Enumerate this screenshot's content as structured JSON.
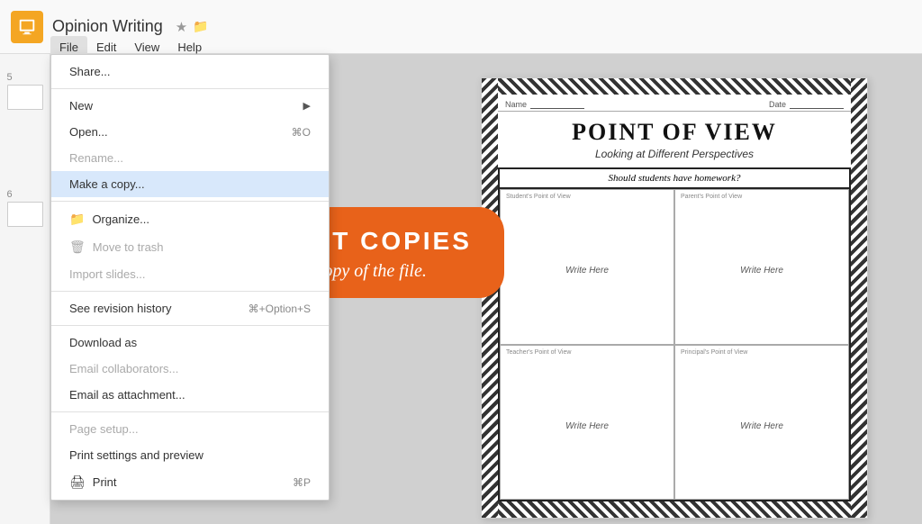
{
  "app": {
    "icon_label": "slides-icon",
    "title": "Opinion Writing",
    "star_icon": "★",
    "folder_icon": "📁"
  },
  "menu": {
    "items": [
      "File",
      "Edit",
      "View",
      "Help"
    ],
    "active": "File"
  },
  "dropdown": {
    "items": [
      {
        "id": "share",
        "label": "Share...",
        "shortcut": "",
        "disabled": false,
        "divider_after": true
      },
      {
        "id": "new",
        "label": "New",
        "shortcut": "",
        "arrow": "▶",
        "disabled": false,
        "divider_after": false
      },
      {
        "id": "open",
        "label": "Open...",
        "shortcut": "⌘O",
        "disabled": false,
        "divider_after": false
      },
      {
        "id": "rename",
        "label": "Rename...",
        "shortcut": "",
        "disabled": true,
        "divider_after": false
      },
      {
        "id": "make-copy",
        "label": "Make a copy...",
        "shortcut": "",
        "highlighted": true,
        "disabled": false,
        "divider_after": true
      },
      {
        "id": "organize",
        "label": "Organize...",
        "shortcut": "",
        "icon": "folder",
        "disabled": false,
        "divider_after": false
      },
      {
        "id": "move-trash",
        "label": "Move to trash",
        "shortcut": "",
        "icon": "trash",
        "disabled": true,
        "divider_after": false
      },
      {
        "id": "import",
        "label": "Import slides...",
        "shortcut": "",
        "disabled": true,
        "divider_after": true
      },
      {
        "id": "revision",
        "label": "See revision history",
        "shortcut": "⌘+Option+S",
        "disabled": false,
        "divider_after": true
      },
      {
        "id": "download",
        "label": "Download as",
        "shortcut": "",
        "disabled": false,
        "divider_after": false
      },
      {
        "id": "email-collab",
        "label": "Email collaborators...",
        "shortcut": "",
        "disabled": true,
        "divider_after": false
      },
      {
        "id": "email-attach",
        "label": "Email as attachment...",
        "shortcut": "",
        "disabled": false,
        "divider_after": true
      },
      {
        "id": "page-setup",
        "label": "Page setup...",
        "shortcut": "",
        "disabled": true,
        "divider_after": false
      },
      {
        "id": "print-preview",
        "label": "Print settings and preview",
        "shortcut": "",
        "disabled": false,
        "divider_after": false
      },
      {
        "id": "print",
        "label": "Print",
        "shortcut": "⌘P",
        "icon": "print",
        "disabled": false,
        "divider_after": false
      }
    ]
  },
  "sidebar": {
    "slides": [
      {
        "num": "5"
      },
      {
        "num": "6"
      }
    ]
  },
  "slide": {
    "name_label": "Name",
    "date_label": "Date",
    "title": "POINT OF VIEW",
    "subtitle": "Looking at Different Perspectives",
    "table_header": "Should students have homework?",
    "cells": [
      {
        "label": "Student's Point of View",
        "write": "Write Here"
      },
      {
        "label": "Parent's Point of View",
        "write": "Write Here"
      },
      {
        "label": "Teacher's Point of View",
        "write": "Write Here"
      },
      {
        "label": "Principal's Point of View",
        "write": "Write Here"
      }
    ]
  },
  "banner": {
    "title": "STUDENT COPIES",
    "subtitle": "Make a copy of the file."
  }
}
